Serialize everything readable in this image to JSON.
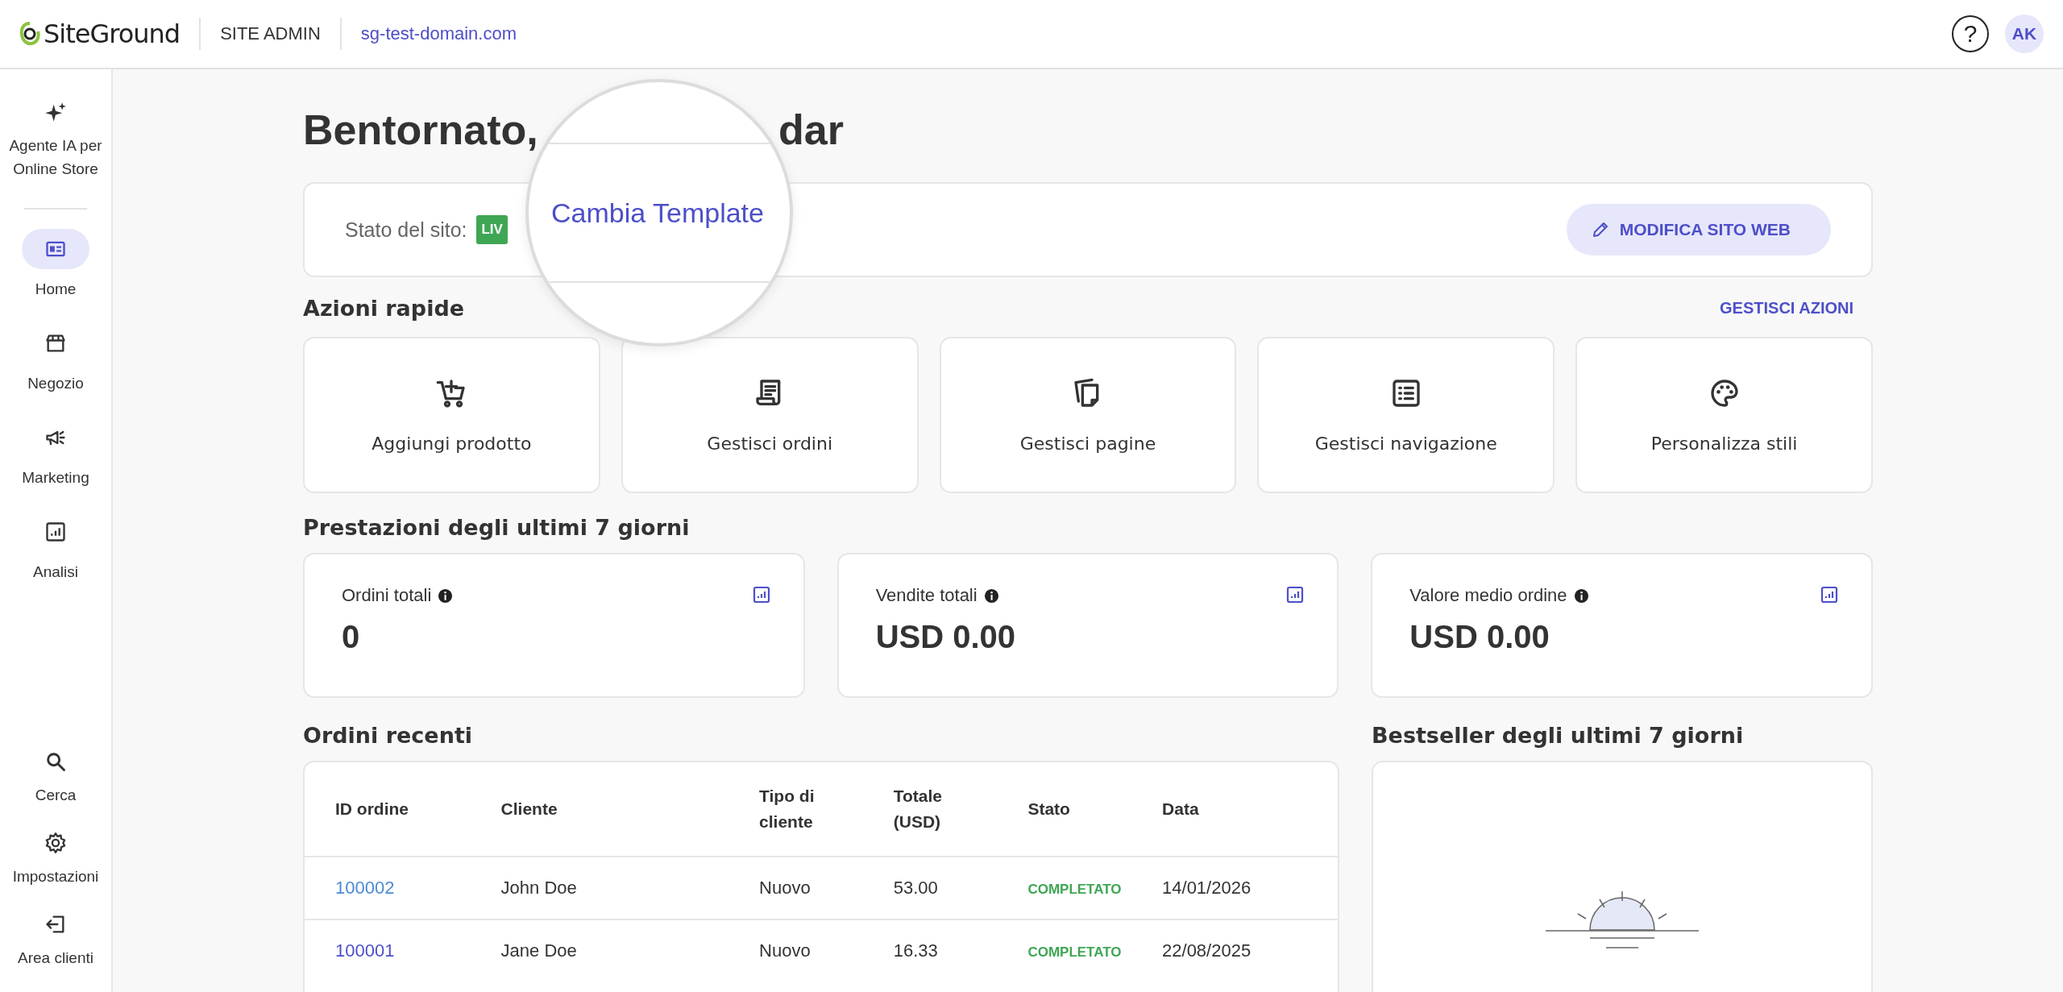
{
  "header": {
    "logo": "SiteGround",
    "section": "SITE ADMIN",
    "domain": "sg-test-domain.com",
    "help": "?",
    "avatar": "AK"
  },
  "sidebar": {
    "top": [
      {
        "kind": "sparkle",
        "label": "Agente IA per Online Store",
        "selected": false
      }
    ],
    "items": [
      {
        "kind": "home",
        "label": "Home",
        "selected": true
      },
      {
        "kind": "store",
        "label": "Negozio",
        "selected": false
      },
      {
        "kind": "megaphone",
        "label": "Marketing",
        "selected": false
      },
      {
        "kind": "chart",
        "label": "Analisi",
        "selected": false
      }
    ],
    "bottom": [
      {
        "kind": "search",
        "label": "Cerca",
        "selected": false
      },
      {
        "kind": "gear",
        "label": "Impostazioni",
        "selected": false
      },
      {
        "kind": "exit",
        "label": "Area clienti",
        "selected": false
      }
    ]
  },
  "greeting": {
    "start": "Bentornato,",
    "end": "dar"
  },
  "site_status": {
    "label": "Stato del sito:",
    "badge": "LIV",
    "edit_button": "MODIFICA SITO WEB"
  },
  "magnifier": {
    "link": "Cambia Template"
  },
  "quick_actions": {
    "title": "Azioni rapide",
    "manage": "GESTISCI AZIONI",
    "items": [
      {
        "kind": "cart",
        "label": "Aggiungi prodotto"
      },
      {
        "kind": "receipt",
        "label": "Gestisci ordini"
      },
      {
        "kind": "pages",
        "label": "Gestisci pagine"
      },
      {
        "kind": "list",
        "label": "Gestisci navigazione"
      },
      {
        "kind": "palette",
        "label": "Personalizza stili"
      }
    ]
  },
  "performance": {
    "title": "Prestazioni degli ultimi 7 giorni",
    "cards": [
      {
        "label": "Ordini totali",
        "value": "0"
      },
      {
        "label": "Vendite totali",
        "value": "USD 0.00"
      },
      {
        "label": "Valore medio ordine",
        "value": "USD 0.00"
      }
    ]
  },
  "recent_orders": {
    "title": "Ordini recenti",
    "columns": [
      "ID ordine",
      "Cliente",
      "Tipo di cliente",
      "Totale (USD)",
      "Stato",
      "Data"
    ],
    "rows": [
      {
        "id": "100002",
        "visited": false,
        "customer": "John Doe",
        "type": "Nuovo",
        "total": "53.00",
        "status": "COMPLETATO",
        "date": "14/01/2026"
      },
      {
        "id": "100001",
        "visited": true,
        "customer": "Jane Doe",
        "type": "Nuovo",
        "total": "16.33",
        "status": "COMPLETATO",
        "date": "22/08/2025"
      }
    ]
  },
  "bestsellers": {
    "title": "Bestseller degli ultimi 7 giorni"
  }
}
